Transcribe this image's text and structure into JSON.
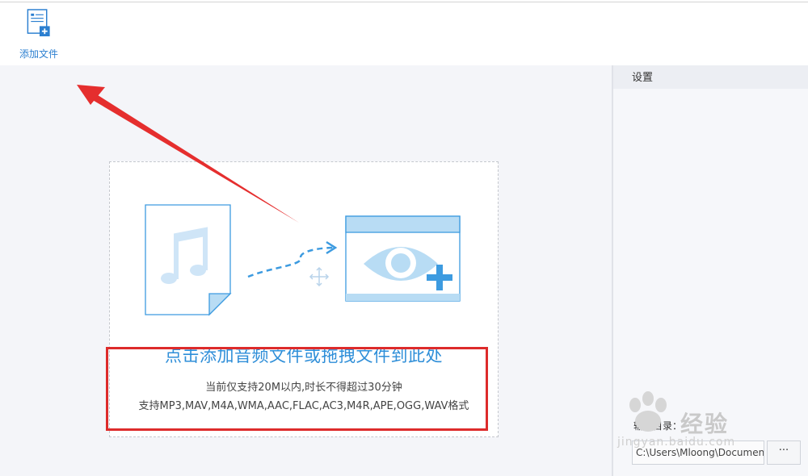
{
  "toolbar": {
    "add_file_label": "添加文件"
  },
  "drop_zone": {
    "title": "点击添加音频文件或拖拽文件到此处",
    "subtitle": "当前仅支持20M以内,时长不得超过30分钟",
    "formats": "支持MP3,MAV,M4A,WMA,AAC,FLAC,AC3,M4R,APE,OGG,WAV格式"
  },
  "settings": {
    "header": "设置",
    "output_dir_label": "输出目录：",
    "output_dir_value": "C:\\Users\\Mloong\\Documents",
    "browse_label": "···"
  },
  "watermark": {
    "text": "经验",
    "url": "jingyan.baidu.com"
  },
  "colors": {
    "accent": "#2e8ed8",
    "annotation": "#dd2b2b",
    "icon_fill": "#b8dcf4"
  },
  "icons": {
    "add_file": "add-file-icon",
    "music_file": "music-file-icon",
    "eye_window": "eye-window-icon",
    "move": "move-icon"
  }
}
